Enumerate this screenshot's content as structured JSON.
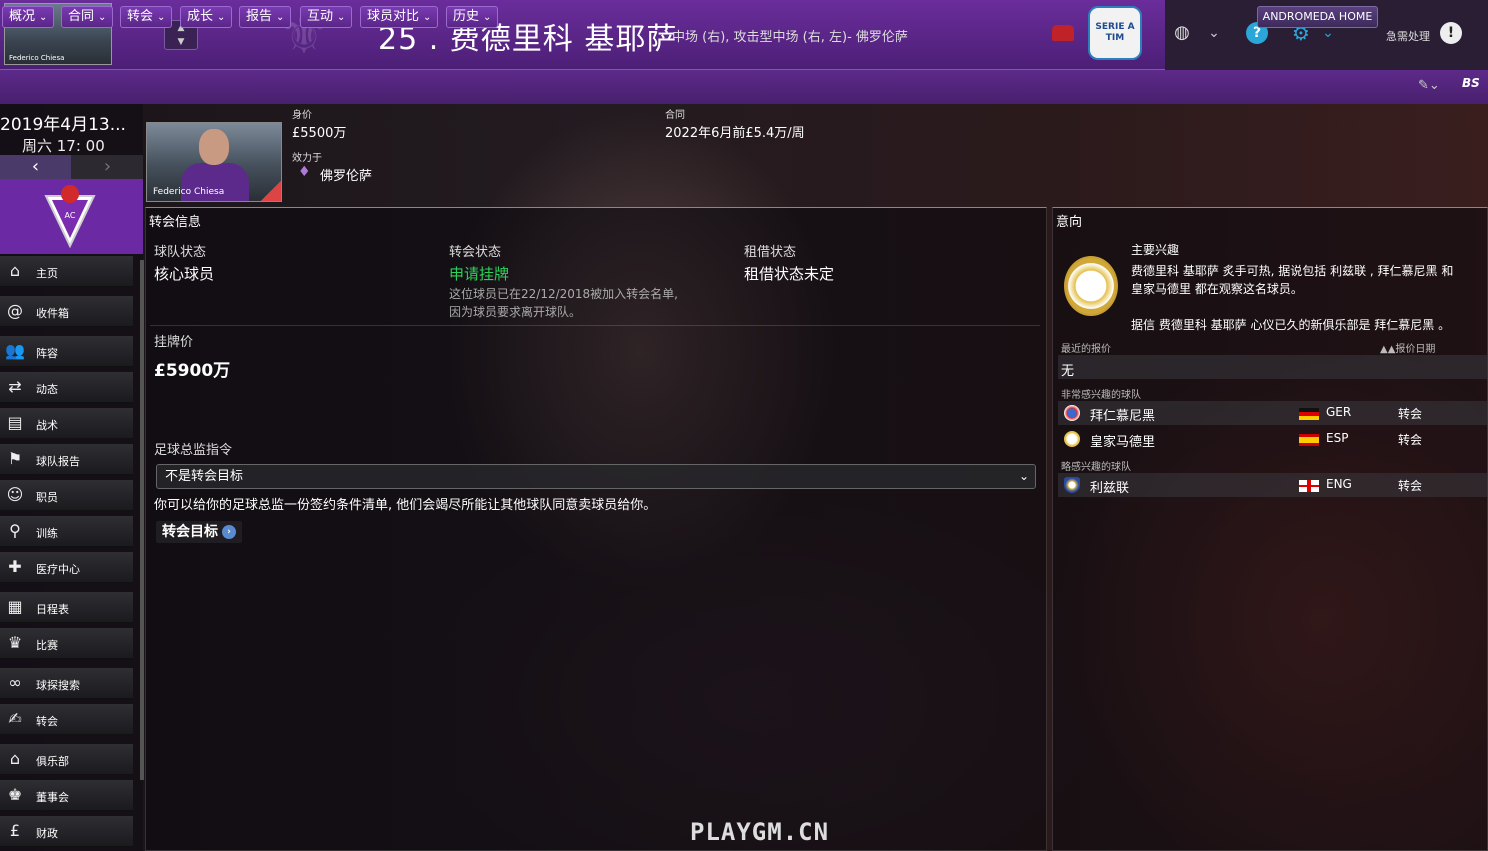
{
  "header": {
    "photo_caption": "Federico Chiesa",
    "player_title": "25 . 费德里科 基耶萨",
    "positions": "中场 (右), 攻击型中场 (右, 左)- 佛罗伦萨",
    "league_badge": "SERIE A TIM",
    "urgent_label": "急需处理"
  },
  "nav": {
    "tabs": [
      "概况",
      "合同",
      "转会",
      "成长",
      "报告",
      "互动",
      "球员对比",
      "历史"
    ],
    "home_button": "ANDROMEDA HOME",
    "right_logo": "BS"
  },
  "sidebar": {
    "date": "2019年4月13...",
    "time": "周六 17: 00",
    "items": [
      {
        "label": "主页",
        "icon": "home-icon"
      },
      {
        "label": "收件箱",
        "icon": "at-icon"
      },
      {
        "label": "阵容",
        "icon": "squad-icon"
      },
      {
        "label": "动态",
        "icon": "dynamics-icon"
      },
      {
        "label": "战术",
        "icon": "tactics-icon"
      },
      {
        "label": "球队报告",
        "icon": "team-report-icon"
      },
      {
        "label": "职员",
        "icon": "staff-icon"
      },
      {
        "label": "训练",
        "icon": "training-icon"
      },
      {
        "label": "医疗中心",
        "icon": "medical-icon"
      },
      {
        "label": "日程表",
        "icon": "calendar-icon"
      },
      {
        "label": "比赛",
        "icon": "trophy-icon"
      },
      {
        "label": "球探搜索",
        "icon": "binoculars-icon"
      },
      {
        "label": "转会",
        "icon": "transfer-icon"
      },
      {
        "label": "俱乐部",
        "icon": "club-icon"
      },
      {
        "label": "董事会",
        "icon": "board-icon"
      },
      {
        "label": "财政",
        "icon": "finance-icon"
      }
    ]
  },
  "player_info": {
    "photo_caption": "Federico Chiesa",
    "value_label": "身价",
    "value": "£5500万",
    "club_label": "效力于",
    "club": "佛罗伦萨",
    "contract_label": "合同",
    "contract": "2022年6月前£5.4万/周"
  },
  "transfer_panel": {
    "title": "转会信息",
    "squad_status_label": "球队状态",
    "squad_status": "核心球员",
    "transfer_status_label": "转会状态",
    "transfer_status": "申请挂牌",
    "transfer_note_1": "这位球员已在22/12/2018被加入转会名单,",
    "transfer_note_2": "因为球员要求离开球队。",
    "loan_status_label": "租借状态",
    "loan_status": "租借状态未定",
    "asking_price_label": "挂牌价",
    "asking_price": "£5900万",
    "director_label": "足球总监指令",
    "director_select": "不是转会目标",
    "director_note": "你可以给你的足球总监一份签约条件清单, 他们会竭尽所能让其他球队同意卖球员给你。",
    "target_button": "转会目标"
  },
  "interest_panel": {
    "title": "意向",
    "main_interest_label": "主要兴趣",
    "interest_text_1": "费德里科 基耶萨 炙手可热, 据说包括 利兹联 , 拜仁慕尼黑 和",
    "interest_text_2": "皇家马德里 都在观察这名球员。",
    "interest_text_3": "据信 费德里科 基耶萨 心仪已久的新俱乐部是 拜仁慕尼黑 。",
    "recent_offers_label": "最近的报价",
    "offer_date_label": "▲▲报价日期",
    "recent_offers_value": "无",
    "very_interested_label": "非常感兴趣的球队",
    "slightly_interested_label": "略感兴趣的球队",
    "very_interested": [
      {
        "club": "拜仁慕尼黑",
        "nation": "GER",
        "type": "转会"
      },
      {
        "club": "皇家马德里",
        "nation": "ESP",
        "type": "转会"
      }
    ],
    "slightly_interested": [
      {
        "club": "利兹联",
        "nation": "ENG",
        "type": "转会"
      }
    ]
  },
  "watermark": "PLAYGM.CN",
  "colors": {
    "accent": "#6a2d9b",
    "status_green": "#2ed05a"
  }
}
